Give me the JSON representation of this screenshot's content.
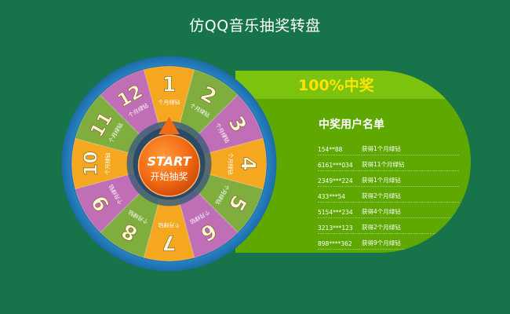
{
  "page": {
    "title": "仿QQ音乐抽奖转盘"
  },
  "panel": {
    "headline": "100%中奖",
    "subtitle": "中奖用户名单",
    "winners": [
      {
        "user": "154**88",
        "prize": "获得1个月绿钻"
      },
      {
        "user": "6161***034",
        "prize": "获得11个月绿钻"
      },
      {
        "user": "2349***224",
        "prize": "获得1个月绿钻"
      },
      {
        "user": "433***54",
        "prize": "获得2个月绿钻"
      },
      {
        "user": "5154***234",
        "prize": "获得4个月绿钻"
      },
      {
        "user": "3213***123",
        "prize": "获得2个月绿钻"
      },
      {
        "user": "898****362",
        "prize": "获得9个月绿钻"
      }
    ]
  },
  "wheel": {
    "segments": [
      {
        "number": "1",
        "label": "个月绿钻",
        "color": "#f4a71f"
      },
      {
        "number": "2",
        "label": "个月绿钻",
        "color": "#7fae3e"
      },
      {
        "number": "3",
        "label": "个月绿钻",
        "color": "#c06fb6"
      },
      {
        "number": "4",
        "label": "个月绿钻",
        "color": "#f4a71f"
      },
      {
        "number": "5",
        "label": "个月绿钻",
        "color": "#7fae3e"
      },
      {
        "number": "6",
        "label": "个月绿钻",
        "color": "#c06fb6"
      },
      {
        "number": "7",
        "label": "个月绿钻",
        "color": "#f4a71f"
      },
      {
        "number": "8",
        "label": "个月绿钻",
        "color": "#7fae3e"
      },
      {
        "number": "9",
        "label": "个月绿钻",
        "color": "#c06fb6"
      },
      {
        "number": "10",
        "label": "个月绿钻",
        "color": "#f4a71f"
      },
      {
        "number": "11",
        "label": "个月绿钻",
        "color": "#7fae3e"
      },
      {
        "number": "12",
        "label": "个月绿钻",
        "color": "#c06fb6"
      }
    ],
    "start_button": {
      "label_en": "START",
      "label_cn": "开始抽奖"
    }
  },
  "colors": {
    "background": "#17744a",
    "panel": "#5fa800",
    "headline": "#ffe400",
    "rim": "#2a86c6",
    "button": "#f36b12"
  }
}
